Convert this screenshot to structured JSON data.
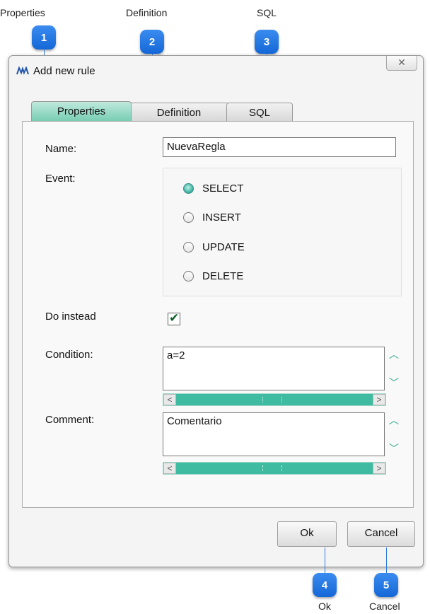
{
  "callouts": [
    {
      "number": "1",
      "label": "Properties"
    },
    {
      "number": "2",
      "label": "Definition"
    },
    {
      "number": "3",
      "label": "SQL"
    },
    {
      "number": "4",
      "label": "Ok"
    },
    {
      "number": "5",
      "label": "Cancel"
    }
  ],
  "dialog": {
    "title": "Add new rule",
    "close_glyph": "✕",
    "tabs": [
      {
        "label": "Properties",
        "active": true
      },
      {
        "label": "Definition",
        "active": false
      },
      {
        "label": "SQL",
        "active": false
      }
    ],
    "fields": {
      "name_label": "Name:",
      "name_value": "NuevaRegla",
      "event_label": "Event:",
      "events": [
        {
          "label": "SELECT",
          "selected": true
        },
        {
          "label": "INSERT",
          "selected": false
        },
        {
          "label": "UPDATE",
          "selected": false
        },
        {
          "label": "DELETE",
          "selected": false
        }
      ],
      "do_instead_label": "Do instead",
      "do_instead_checked": true,
      "check_glyph": "✔",
      "condition_label": "Condition:",
      "condition_value": "a=2",
      "comment_label": "Comment:",
      "comment_value": "Comentario"
    },
    "buttons": {
      "ok": "Ok",
      "cancel": "Cancel"
    },
    "scroll_glyphs": {
      "up": "︿",
      "down": "﹀",
      "left": "<",
      "right": ">"
    }
  },
  "colors": {
    "accent": "#2f7ae0",
    "tab_active": "#78cdb3",
    "scrollbar": "#3ebba0"
  }
}
